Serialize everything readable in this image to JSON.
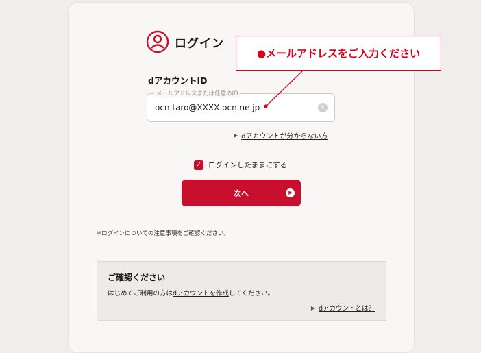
{
  "login": {
    "title": "ログイン"
  },
  "account_field": {
    "label": "dアカウントID",
    "legend": "メールアドレスまたは任意のID",
    "value": "ocn.taro@XXXX.ocn.ne.jp"
  },
  "forgot_link": "dアカウントが分からない方",
  "remember": {
    "label": "ログインしたままにする",
    "checked": true
  },
  "next_button": "次へ",
  "notice": {
    "prefix": "※ログインについての",
    "link": "注意事項",
    "suffix": "をご確認ください。"
  },
  "confirm": {
    "title": "ご確認ください",
    "text_prefix": "はじめてご利用の方は",
    "text_link": "dアカウントを作成",
    "text_suffix": "してください。",
    "about_link": "dアカウントとは？"
  },
  "callout": {
    "text": "●メールアドレスをご入力ください",
    "color": "#d8001a"
  },
  "colors": {
    "brand": "#c8102e"
  }
}
